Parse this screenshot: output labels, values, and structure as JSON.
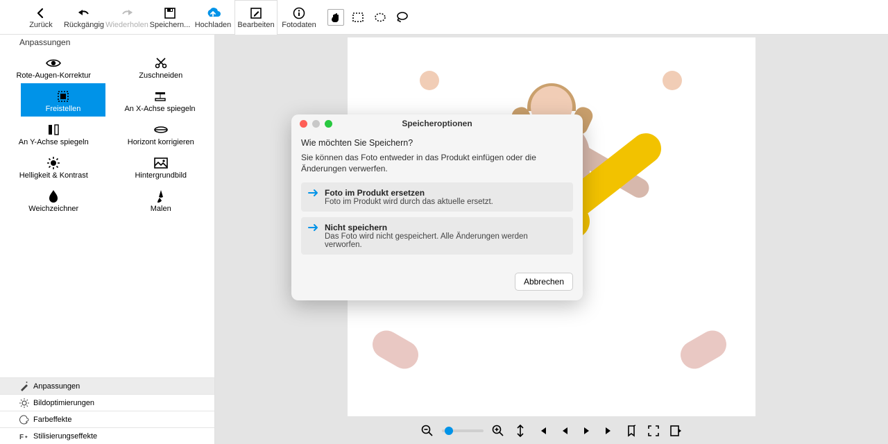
{
  "toolbar": {
    "back": "Zurück",
    "undo": "Rückgängig",
    "redo": "Wiederholen",
    "save": "Speichern...",
    "upload": "Hochladen",
    "edit": "Bearbeiten",
    "photodata": "Fotodaten"
  },
  "side": {
    "title": "Anpassungen",
    "tools": {
      "redeye": "Rote-Augen-Korrektur",
      "crop": "Zuschneiden",
      "cutout": "Freistellen",
      "flipx": "An X-Achse spiegeln",
      "flipy": "An Y-Achse spiegeln",
      "horizon": "Horizont korrigieren",
      "brightness": "Helligkeit & Kontrast",
      "background": "Hintergrundbild",
      "blur": "Weichzeichner",
      "paint": "Malen"
    },
    "tabs": {
      "adjust": "Anpassungen",
      "optimize": "Bildoptimierungen",
      "color": "Farbeffekte",
      "stylize": "Stilisierungseffekte"
    }
  },
  "dialog": {
    "title": "Speicheroptionen",
    "question": "Wie möchten Sie Speichern?",
    "description": "Sie können das Foto entweder in das Produkt einfügen oder die Änderungen verwerfen.",
    "opt1_title": "Foto im Produkt ersetzen",
    "opt1_desc": "Foto im Produkt wird durch das aktuelle ersetzt.",
    "opt2_title": "Nicht speichern",
    "opt2_desc": "Das Foto wird nicht gespeichert. Alle Änderungen werden verworfen.",
    "cancel": "Abbrechen"
  }
}
